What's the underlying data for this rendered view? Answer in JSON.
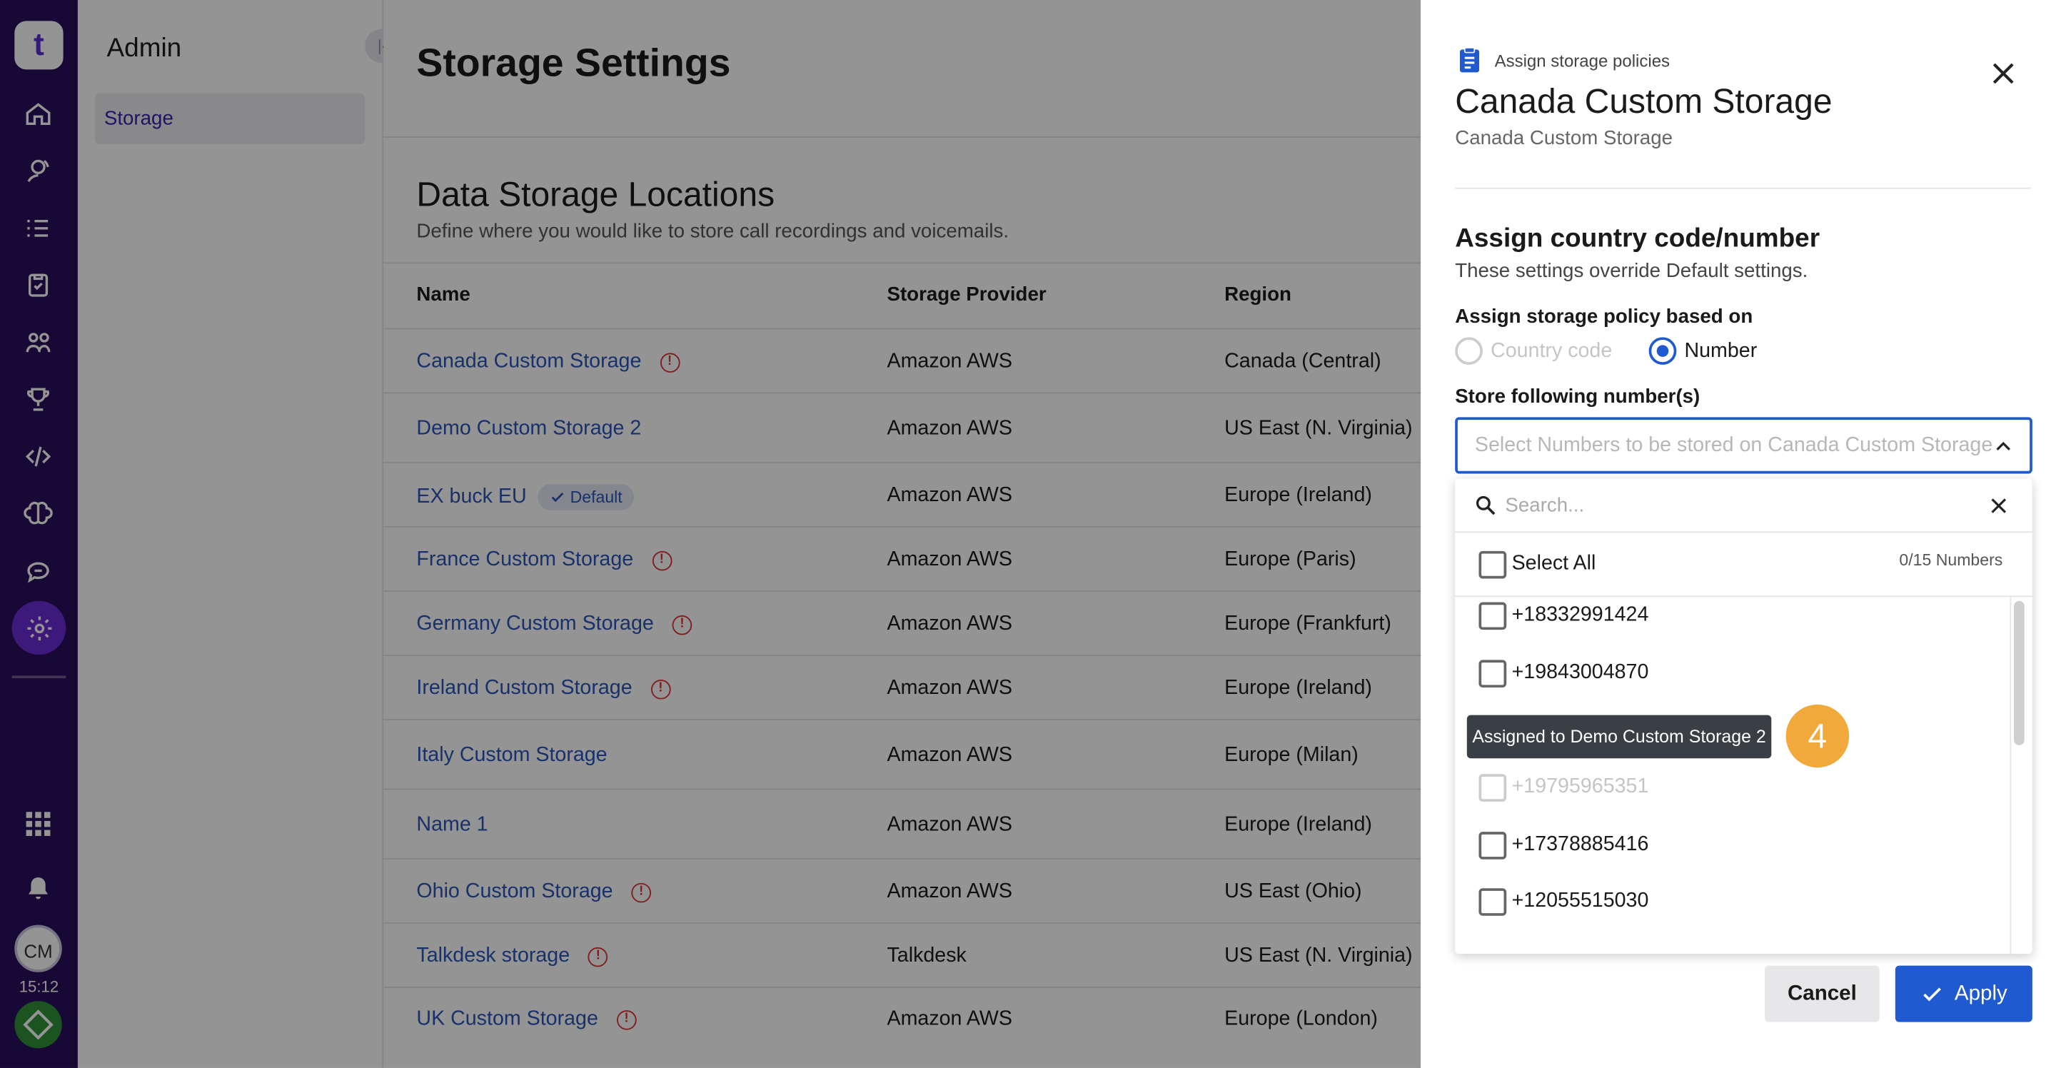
{
  "rail": {
    "logo": "t",
    "avatar": "CM",
    "time": "15:12",
    "icons": [
      "home-icon",
      "live-icon",
      "list-icon",
      "clipboard-icon",
      "team-icon",
      "trophy-icon",
      "code-icon",
      "brain-icon",
      "chat-icon",
      "settings-icon",
      "apps-icon",
      "bell-icon"
    ]
  },
  "sidebar": {
    "title": "Admin",
    "items": [
      {
        "label": "Storage"
      }
    ]
  },
  "main": {
    "title": "Storage Settings",
    "section_title": "Data Storage Locations",
    "section_subtitle": "Define where you would like to store call recordings and voicemails.",
    "columns": [
      "Name",
      "Storage Provider",
      "Region"
    ],
    "default_badge": "Default",
    "rows": [
      {
        "name": "Canada Custom Storage",
        "provider": "Amazon AWS",
        "region": "Canada (Central)",
        "warning": true,
        "default": false
      },
      {
        "name": "Demo Custom Storage 2",
        "provider": "Amazon AWS",
        "region": "US East (N. Virginia)",
        "warning": false,
        "default": false
      },
      {
        "name": "EX buck EU",
        "provider": "Amazon AWS",
        "region": "Europe (Ireland)",
        "warning": false,
        "default": true
      },
      {
        "name": "France Custom Storage",
        "provider": "Amazon AWS",
        "region": "Europe (Paris)",
        "warning": true,
        "default": false
      },
      {
        "name": "Germany Custom Storage",
        "provider": "Amazon AWS",
        "region": "Europe (Frankfurt)",
        "warning": true,
        "default": false
      },
      {
        "name": "Ireland Custom Storage",
        "provider": "Amazon AWS",
        "region": "Europe (Ireland)",
        "warning": true,
        "default": false
      },
      {
        "name": "Italy Custom Storage",
        "provider": "Amazon AWS",
        "region": "Europe (Milan)",
        "warning": false,
        "default": false
      },
      {
        "name": "Name 1",
        "provider": "Amazon AWS",
        "region": "Europe (Ireland)",
        "warning": false,
        "default": false
      },
      {
        "name": "Ohio Custom Storage",
        "provider": "Amazon AWS",
        "region": "US East (Ohio)",
        "warning": true,
        "default": false
      },
      {
        "name": "Talkdesk storage",
        "provider": "Talkdesk",
        "region": "US East (N. Virginia)",
        "warning": true,
        "default": false
      },
      {
        "name": "UK Custom Storage",
        "provider": "Amazon AWS",
        "region": "Europe (London)",
        "warning": true,
        "default": false
      }
    ]
  },
  "drawer": {
    "kicker": "Assign storage policies",
    "title": "Canada Custom Storage",
    "subtitle": "Canada Custom Storage",
    "section_title": "Assign country code/number",
    "section_subtitle": "These settings override Default settings.",
    "policy_label": "Assign storage policy based on",
    "radio_country": "Country code",
    "radio_number": "Number",
    "store_label": "Store following number(s)",
    "select_placeholder": "Select Numbers to be stored on Canada Custom Storage",
    "search_placeholder": "Search...",
    "select_all": "Select All",
    "count": "0/15 Numbers",
    "numbers": [
      {
        "value": "+18332991424",
        "disabled": false
      },
      {
        "value": "+19843004870",
        "disabled": false
      },
      {
        "value": "+19795965351",
        "disabled": true
      },
      {
        "value": "+17378885416",
        "disabled": false
      },
      {
        "value": "+12055515030",
        "disabled": false
      }
    ],
    "tooltip": "Assigned to Demo Custom Storage 2",
    "step": "4",
    "cancel": "Cancel",
    "apply": "Apply"
  },
  "colors": {
    "accent": "#1f5ad0",
    "rail": "#2a0f5c",
    "step": "#f2a93b",
    "warn": "#dd3333"
  }
}
